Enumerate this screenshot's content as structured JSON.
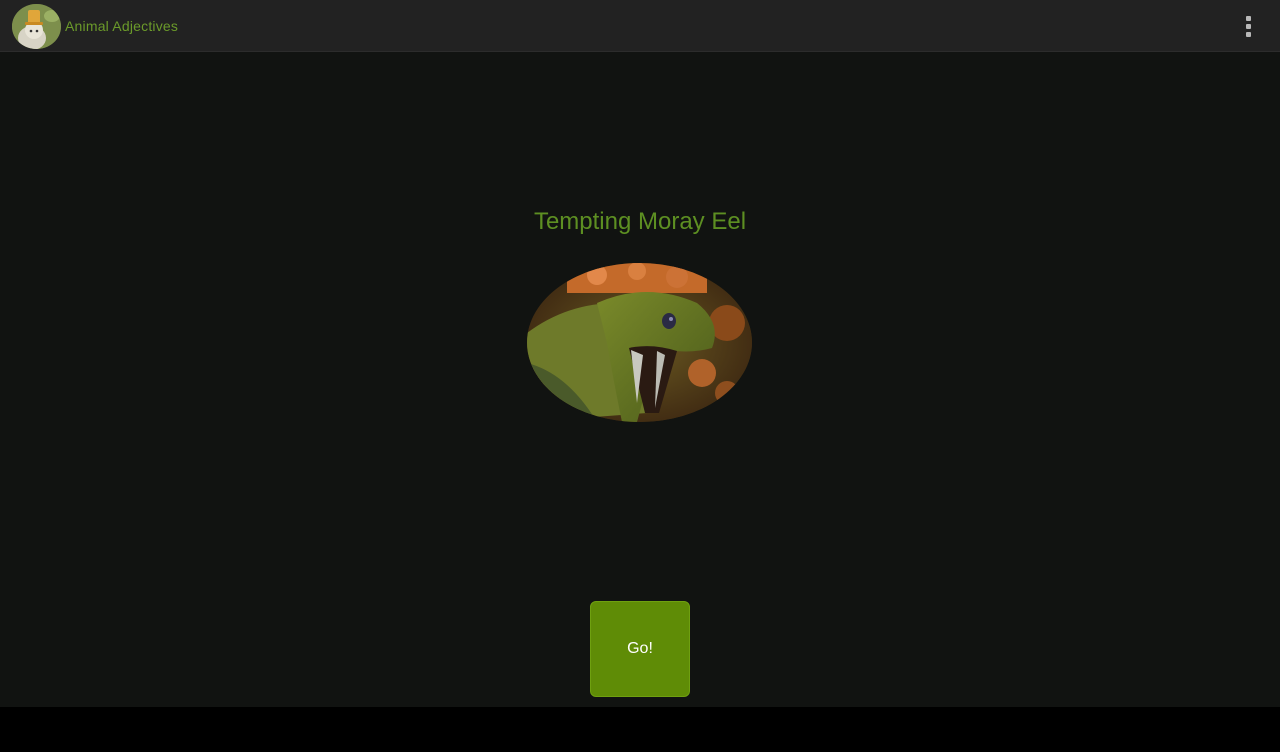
{
  "action_bar": {
    "app_title": "Animal Adjectives",
    "app_icon": "animal-with-hat-icon",
    "overflow_icon": "overflow-menu-icon"
  },
  "main": {
    "adjective_title": "Tempting Moray Eel",
    "animal_image": "moray-eel-photo",
    "go_label": "Go!"
  },
  "colors": {
    "action_bar_bg": "#222222",
    "content_bg": "#111311",
    "accent_text": "#5d8f22",
    "button_bg": "#5f8c06",
    "nav_bar_bg": "#000000"
  }
}
